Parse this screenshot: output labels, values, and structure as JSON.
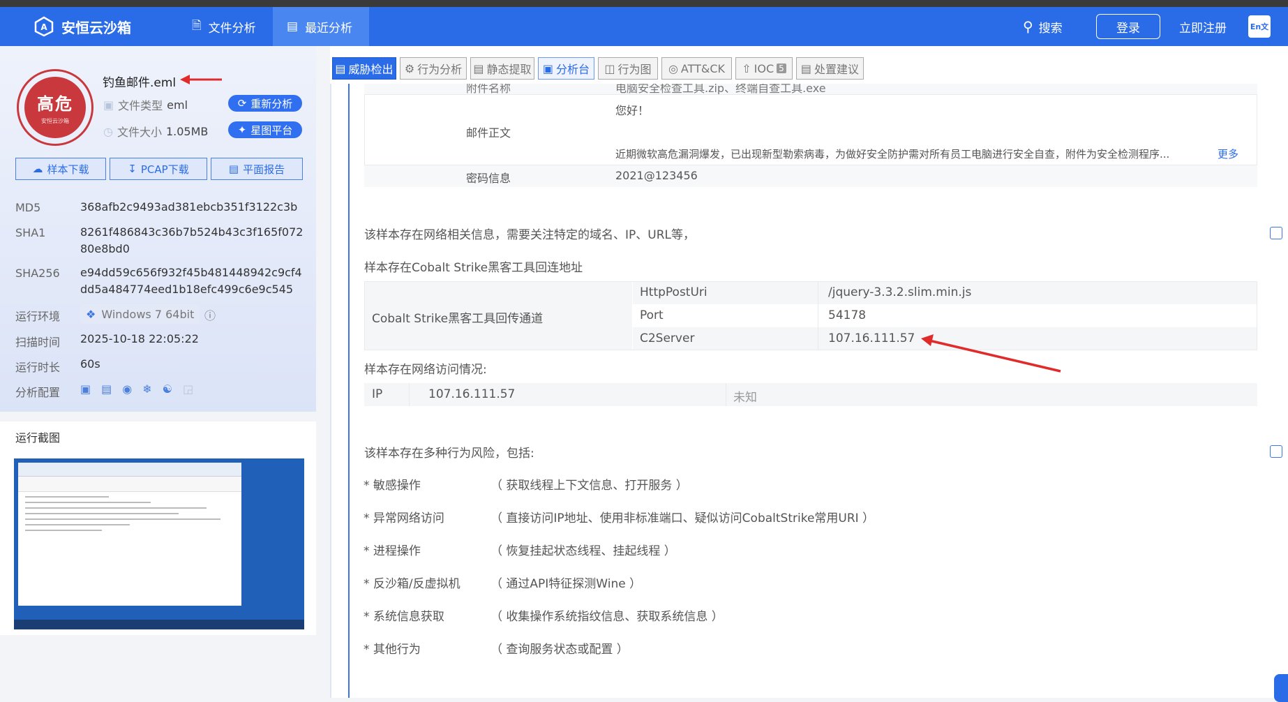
{
  "nav": {
    "brand": "安恒云沙箱",
    "tab_file": "文件分析",
    "tab_recent": "最近分析",
    "search": "搜索",
    "login": "登录",
    "register": "立即注册",
    "lang": "En文"
  },
  "file": {
    "seal_text": "高危",
    "seal_sub": "安恒云沙箱",
    "name": "钓鱼邮件.eml",
    "type_label": "文件类型",
    "type_value": "eml",
    "size_label": "文件大小",
    "size_value": "1.05MB",
    "reanalyze": "重新分析",
    "star_platform": "星图平台",
    "btn_sample": "样本下载",
    "btn_pcap": "PCAP下载",
    "btn_report": "平面报告"
  },
  "hashes": {
    "md5_label": "MD5",
    "md5": "368afb2c9493ad381ebcb351f3122c3b",
    "sha1_label": "SHA1",
    "sha1": "8261f486843c36b7b524b43c3f165f07280e8bd0",
    "sha256_label": "SHA256",
    "sha256": "e94dd59c656f932f45b481448942c9cf4dd5a484774eed1b18efc499c6e9c545"
  },
  "env": {
    "env_label": "运行环境",
    "env_value": "Windows 7 64bit",
    "time_label": "扫描时间",
    "time_value": "2025-10-18 22:05:22",
    "dur_label": "运行时长",
    "dur_value": "60s",
    "cfg_label": "分析配置"
  },
  "screenshot": {
    "title": "运行截图"
  },
  "tabs": [
    "威胁检出",
    "行为分析",
    "静态提取",
    "分析台",
    "行为图",
    "ATT&CK",
    "IOC",
    "处置建议"
  ],
  "ioc_count": "5",
  "mail": {
    "attach_label": "附件名称",
    "attach_value": "电脑安全检查工具.zip、终端自查工具.exe",
    "body_label": "邮件正文",
    "body_greeting": "您好！",
    "body_text": "近期微软高危漏洞爆发，已出现新型勒索病毒，为做好安全防护需对所有员工电脑进行安全自查，附件为安全检测程序...",
    "more": "更多",
    "pwd_label": "密码信息",
    "pwd_value": "2021@123456"
  },
  "network": {
    "intro": "该样本存在网络相关信息，需要关注特定的域名、IP、URL等，",
    "cs_title": "样本存在Cobalt Strike黑客工具回连地址",
    "cs_channel": "Cobalt Strike黑客工具回传通道",
    "cs_rows": [
      {
        "k": "HttpPostUri",
        "v": "/jquery-3.3.2.slim.min.js"
      },
      {
        "k": "Port",
        "v": "54178"
      },
      {
        "k": "C2Server",
        "v": "107.16.111.57"
      }
    ],
    "access_title": "样本存在网络访问情况:",
    "ip_label": "IP",
    "ip_value": "107.16.111.57",
    "ip_status": "未知"
  },
  "behavior": {
    "intro": "该样本存在多种行为风险，包括:",
    "items": [
      {
        "name": "* 敏感操作",
        "desc": "（ 获取线程上下文信息、打开服务 ）"
      },
      {
        "name": "* 异常网络访问",
        "desc": "（ 直接访问IP地址、使用非标准端口、疑似访问CobaltStrike常用URI ）"
      },
      {
        "name": "* 进程操作",
        "desc": "（ 恢复挂起状态线程、挂起线程 ）"
      },
      {
        "name": "* 反沙箱/反虚拟机",
        "desc": "（ 通过API特征探测Wine ）"
      },
      {
        "name": "* 系统信息获取",
        "desc": "（ 收集操作系统指纹信息、获取系统信息 ）"
      },
      {
        "name": "* 其他行为",
        "desc": "（ 查询服务状态或配置 ）"
      }
    ]
  },
  "colors": {
    "brand": "#2a6be8",
    "danger": "#c8383c",
    "arrow": "#e02b2b"
  }
}
